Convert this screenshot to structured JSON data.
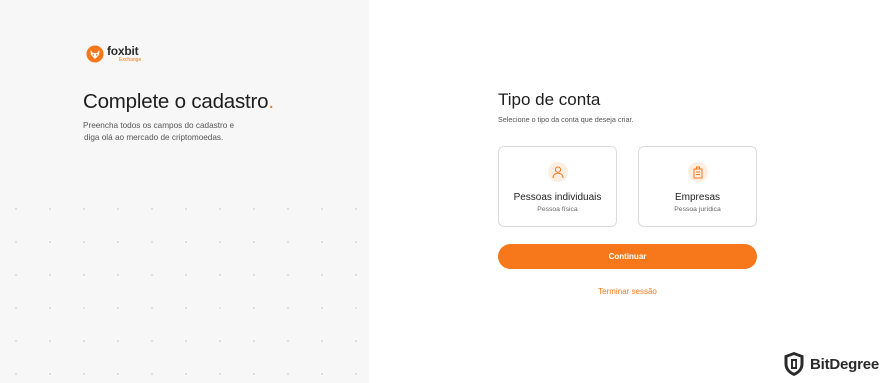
{
  "brand": {
    "name": "foxbit",
    "sub": "Exchange",
    "accent": "#f7781a"
  },
  "left": {
    "headline": "Complete o cadastro",
    "headline_dot": ".",
    "sub_line1": "Preencha todos os campos do cadastro e",
    "sub_line2": "diga olá ao mercado de criptomoedas."
  },
  "right": {
    "title": "Tipo de conta",
    "subtitle": "Selecione o tipo da conta que deseja criar.",
    "options": [
      {
        "title": "Pessoas individuais",
        "sub": "Pessoa física",
        "icon": "person-icon"
      },
      {
        "title": "Empresas",
        "sub": "Pessoa jurídica",
        "icon": "building-icon"
      }
    ],
    "continue_label": "Continuar",
    "logout_label": "Terminar sessão"
  },
  "watermark": {
    "text": "BitDegree",
    "icon": "bitdegree-shield-icon"
  }
}
